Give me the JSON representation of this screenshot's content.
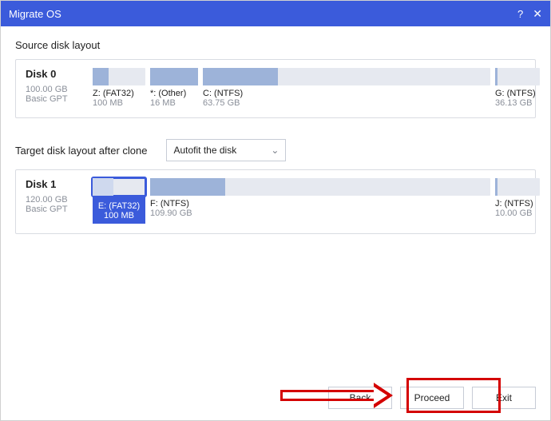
{
  "titlebar": {
    "title": "Migrate OS"
  },
  "source": {
    "label": "Source disk layout",
    "disk": {
      "name": "Disk 0",
      "size": "100.00 GB",
      "type": "Basic GPT"
    },
    "partitions": [
      {
        "label": "Z: (FAT32)",
        "size": "100 MB"
      },
      {
        "label": "*: (Other)",
        "size": "16 MB"
      },
      {
        "label": "C: (NTFS)",
        "size": "63.75 GB"
      },
      {
        "label": "G: (NTFS)",
        "size": "36.13 GB"
      }
    ]
  },
  "target": {
    "label": "Target disk layout after clone",
    "fit_mode": "Autofit the disk",
    "disk": {
      "name": "Disk 1",
      "size": "120.00 GB",
      "type": "Basic GPT"
    },
    "partitions": [
      {
        "label": "E: (FAT32)",
        "size": "100 MB"
      },
      {
        "label": "F: (NTFS)",
        "size": "109.90 GB"
      },
      {
        "label": "J: (NTFS)",
        "size": "10.00 GB"
      }
    ]
  },
  "buttons": {
    "back": "Back",
    "proceed": "Proceed",
    "exit": "Exit"
  }
}
